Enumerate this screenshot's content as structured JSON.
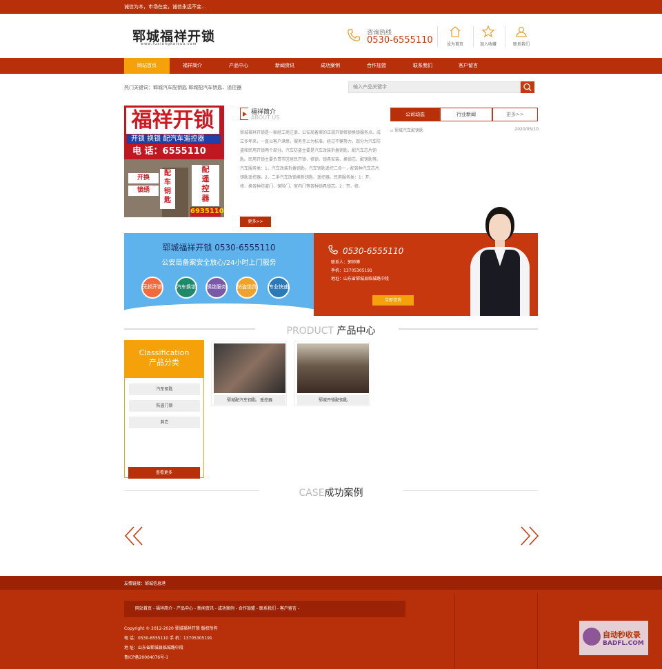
{
  "topbar": {
    "slogan": "诚信为本，市场在变，诚信永远不变..."
  },
  "logo": {
    "title": "郓城福祥开锁",
    "url": "www.fuxiangkaisuo.com"
  },
  "hotline": {
    "label": "咨询热线",
    "phone": "0530-6555110"
  },
  "tools": [
    {
      "label": "设为首页",
      "icon": "home-icon"
    },
    {
      "label": "加入收藏",
      "icon": "star-icon"
    },
    {
      "label": "联系我们",
      "icon": "contact-icon"
    }
  ],
  "nav": [
    "网站首页",
    "福祥简介",
    "产品中心",
    "新闻资讯",
    "成功案例",
    "合作加盟",
    "联系我们",
    "客户留言"
  ],
  "keywords": {
    "text": "热门关键词：郓城汽车配钥匙   郓城配汽车钥匙、遥控器"
  },
  "search": {
    "placeholder": "输入产品关键字"
  },
  "shop_sign": {
    "main": "福祥开锁",
    "sub": "开锁 换锁 配汽车遥控器",
    "phone": "电 话：6555110",
    "side": [
      "配",
      "车",
      "钥",
      "匙"
    ],
    "side2": [
      "配",
      "遥",
      "控",
      "器"
    ],
    "tag1": "开换",
    "tag2": "锁绣",
    "bottom": "6935110"
  },
  "about": {
    "title": "福祥简介",
    "en": "ABOUT US",
    "text": "郓城福祥开锁是一家经工商注册、公安局备案的正规开锁修锁换锁服务点。成立多年来，一直以客户满意，服务至上为标准，经过不懈努力，现分为汽车防盗和民用开锁两个部分。汽车防盗主要是汽车改装折叠钥匙、配汽车芯片钥匙。民用开锁主要负责市区居民开锁、修锁、锁具安装、换锁芯、配钥匙等。汽车服务类：1、汽车改装折叠钥匙，汽车钥匙遥控二合一，配各种汽车芯片钥匙遥控器。2、二手汽车改锁换新钥匙、遥控器。民用服务类：1：开、修、换各种防盗门、保险门、室内门等各种锁具锁芯。2：开、修、",
    "more": "更多>>"
  },
  "news": {
    "tabs": [
      "公司动态",
      "行业新闻",
      "更多>>"
    ],
    "items": [
      {
        "title": "郓城汽车配钥匙",
        "date": "2020/05/10"
      }
    ]
  },
  "banner": {
    "title": "郓城福祥开锁  0530-6555110",
    "subtitle": "公安局备案安全放心/24小时上门服务",
    "circles": [
      "无损开锁",
      "汽车换锁",
      "换锁服务",
      "防盗锁具",
      "专业快速"
    ],
    "phone": "0530-6555110",
    "contact": "联系人：郭师傅",
    "mobile": "手机：13705305191",
    "address": "地址：山东省郓城县临城路中段",
    "consult": "立即咨询"
  },
  "product_section": {
    "en": "PRODUCT",
    "cn": "产品中心"
  },
  "classification": {
    "en": "Classification",
    "cn": "产品分类",
    "items": [
      "汽车钥匙",
      "防盗门锁",
      "其它"
    ],
    "more": "查看更多"
  },
  "products": [
    {
      "caption": "郓城配汽车钥匙、遥控器"
    },
    {
      "caption": "郓城开锁配钥匙"
    }
  ],
  "case_section": {
    "en": "CASE",
    "cn": "成功案例"
  },
  "footer": {
    "links": "友情链接：郓城信息港",
    "nav": "网站首页  -  福祥简介  -  产品中心  -  新闻资讯  -  成功案例  -  合作加盟  -  联系我们  -  客户留言  -",
    "copyright": "Copyright © 2012-2020 郓城福祥开锁 版权所有",
    "tel": "电 话：0530-6555110  手 机：13705305191",
    "address": "地 址：山东省郓城县临城路中段",
    "icp": "鲁ICP备20004076号-1"
  },
  "watermark": {
    "line1": "自动秒收录",
    "line2": "BADFL.COM"
  },
  "colors": {
    "primary": "#b8300a",
    "accent": "#f5a20a",
    "banner_blue": "#5fb3ec"
  }
}
